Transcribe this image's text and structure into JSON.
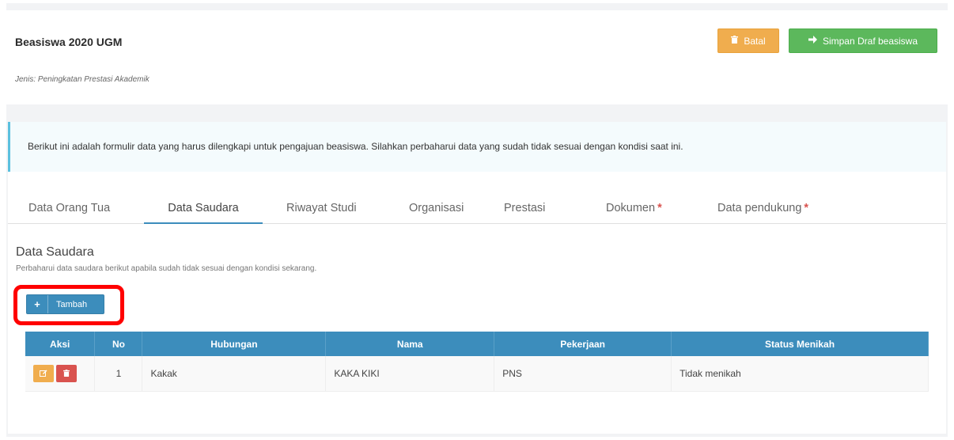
{
  "header": {
    "title": "Beasiswa 2020 UGM",
    "subtitle": "Jenis: Peningkatan Prestasi Akademik",
    "cancel_label": "Batal",
    "save_label": "Simpan Draf beasiswa"
  },
  "alert": {
    "text": "Berikut ini adalah formulir data yang harus dilengkapi untuk pengajuan beasiswa. Silahkan perbaharui data yang sudah tidak sesuai dengan kondisi saat ini."
  },
  "tabs": [
    {
      "label": "Data Orang Tua",
      "required": false
    },
    {
      "label": "Data Saudara",
      "required": false,
      "active": true
    },
    {
      "label": "Riwayat Studi",
      "required": false
    },
    {
      "label": "Organisasi",
      "required": false
    },
    {
      "label": "Prestasi",
      "required": false
    },
    {
      "label": "Dokumen",
      "required": true
    },
    {
      "label": "Data pendukung",
      "required": true
    }
  ],
  "required_mark": "*",
  "section": {
    "title": "Data Saudara",
    "description": "Perbaharui data saudara berikut apabila sudah tidak sesuai dengan kondisi sekarang.",
    "add_label": "Tambah"
  },
  "table": {
    "headers": [
      "Aksi",
      "No",
      "Hubungan",
      "Nama",
      "Pekerjaan",
      "Status Menikah"
    ],
    "rows": [
      {
        "no": "1",
        "hubungan": "Kakak",
        "nama": "KAKA KIKI",
        "pekerjaan": "PNS",
        "status": "Tidak menikah"
      }
    ]
  },
  "colors": {
    "primary": "#3c8dbc",
    "warning": "#f0ad4e",
    "success": "#5cb85c",
    "danger": "#d9534f",
    "highlight": "#ff0000"
  }
}
